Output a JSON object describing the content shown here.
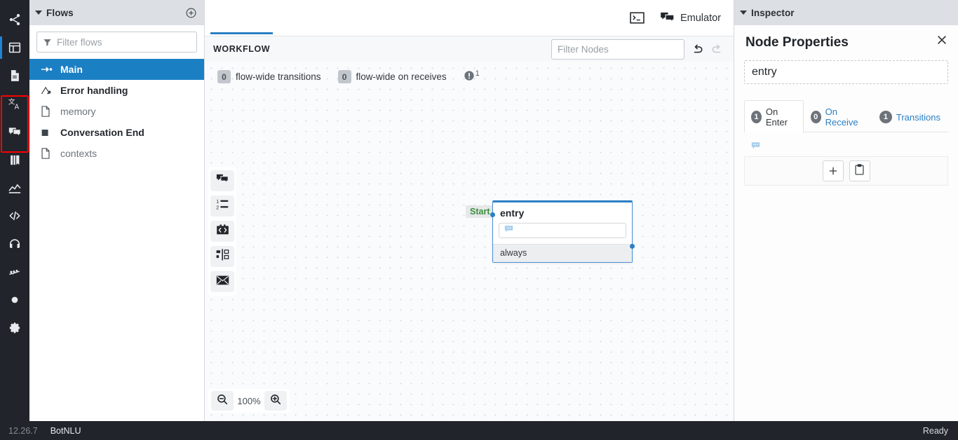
{
  "rail": {
    "items": [
      {
        "icon": "share-nodes-icon",
        "name": "rail-item-share",
        "active": false
      },
      {
        "icon": "layout-panel-icon",
        "name": "rail-item-layout",
        "active": true
      },
      {
        "icon": "document-icon",
        "name": "rail-item-content",
        "active": false
      },
      {
        "icon": "translate-icon",
        "name": "rail-item-translate",
        "active": false
      },
      {
        "icon": "chat-icon",
        "name": "rail-item-qna",
        "active": false
      },
      {
        "icon": "book-icon",
        "name": "rail-item-library",
        "active": false
      },
      {
        "icon": "analytics-icon",
        "name": "rail-item-analytics",
        "active": false
      },
      {
        "icon": "code-icon",
        "name": "rail-item-code",
        "active": false
      },
      {
        "icon": "headset-icon",
        "name": "rail-item-support",
        "active": false
      },
      {
        "icon": "signature-icon",
        "name": "rail-item-testing",
        "active": false
      },
      {
        "icon": "circle-icon",
        "name": "rail-item-record",
        "active": false
      },
      {
        "icon": "gear-icon",
        "name": "rail-item-settings",
        "active": false
      }
    ]
  },
  "flows": {
    "header_title": "Flows",
    "add_label": "+",
    "filter_placeholder": "Filter flows",
    "filter_value": "",
    "items": [
      {
        "label": "Main",
        "icon": "flow-start-icon",
        "selected": true,
        "bold": true
      },
      {
        "label": "Error handling",
        "icon": "flow-error-icon",
        "selected": false,
        "bold": true
      },
      {
        "label": "memory",
        "icon": "file-icon",
        "selected": false,
        "bold": false
      },
      {
        "label": "Conversation End",
        "icon": "square-icon",
        "selected": false,
        "bold": true
      },
      {
        "label": "contexts",
        "icon": "file-icon",
        "selected": false,
        "bold": false
      }
    ]
  },
  "topbar": {
    "console_label": "",
    "emulator_label": "Emulator"
  },
  "workflow": {
    "tab_label": "WORKFLOW",
    "filter_nodes_placeholder": "Filter Nodes",
    "filter_nodes_value": "",
    "undo_label": "Undo",
    "redo_label": "Redo",
    "flow_wide_transitions_count": "0",
    "flow_wide_transitions_label": "flow-wide transitions",
    "flow_wide_on_receives_count": "0",
    "flow_wide_on_receives_label": "flow-wide on receives",
    "warning_count": "1",
    "tools": [
      {
        "name": "tool-say",
        "icon": "chat-icon"
      },
      {
        "name": "tool-choice",
        "icon": "numbered-list-icon"
      },
      {
        "name": "tool-execute",
        "icon": "code-box-icon"
      },
      {
        "name": "tool-router",
        "icon": "split-icon"
      },
      {
        "name": "tool-email",
        "icon": "envelope-icon"
      }
    ],
    "zoom": {
      "out_label": "Zoom out",
      "value": "100%",
      "in_label": "Zoom in"
    }
  },
  "node": {
    "start_chip": "Start",
    "title": "entry",
    "slot_icon": "chat-bubble-icon",
    "transition_label": "always"
  },
  "inspector": {
    "header_title": "Inspector",
    "panel_title": "Node Properties",
    "close_label": "×",
    "node_name": "entry",
    "tabs": [
      {
        "badge": "1",
        "label": "On Enter",
        "active": true
      },
      {
        "badge": "0",
        "label": "On Receive",
        "active": false
      },
      {
        "badge": "1",
        "label": "Transitions",
        "active": false
      }
    ],
    "content_icon": "chat-bubble-icon",
    "add_label": "+",
    "paste_label": "Paste"
  },
  "statusbar": {
    "version": "12.26.7",
    "engine": "BotNLU",
    "status": "Ready"
  },
  "colors": {
    "rail_bg": "#21252b",
    "accent_blue": "#1b7fc4",
    "selected_flow": "#1b7fc4",
    "highlight_red": "#ff0000",
    "panel_header": "#dcdfe3",
    "canvas_bg": "#fafbfc",
    "start_green": "#3c8f3c"
  }
}
